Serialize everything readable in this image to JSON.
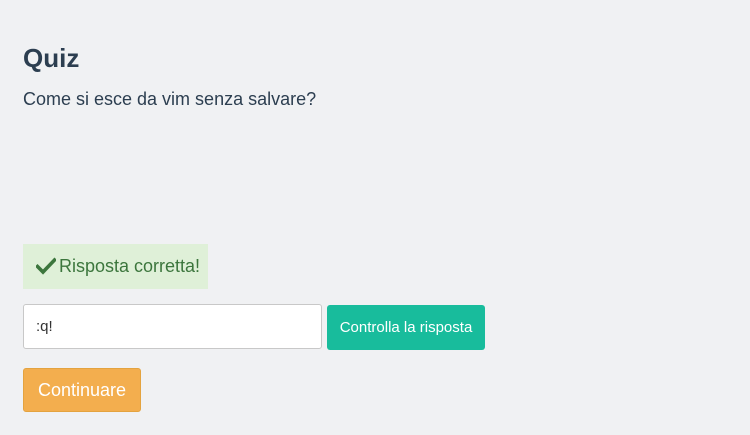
{
  "quiz": {
    "title": "Quiz",
    "question": "Come si esce da vim senza salvare?"
  },
  "feedback": {
    "icon": "check-icon",
    "text": "Risposta corretta!",
    "color": "#3c763d",
    "background": "#dff0d8"
  },
  "answer": {
    "value": ":q!",
    "placeholder": ""
  },
  "buttons": {
    "check_label": "Controlla la risposta",
    "check_color": "#18bc9c",
    "continue_label": "Continuare",
    "continue_color": "#f3ae4e"
  }
}
